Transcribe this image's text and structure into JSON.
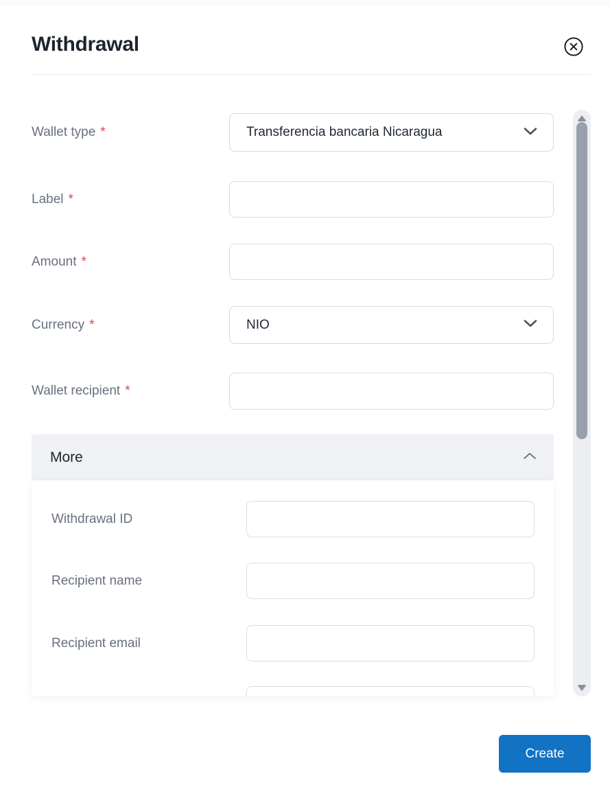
{
  "modal": {
    "title": "Withdrawal",
    "close_icon": "circled-x"
  },
  "form": {
    "required_marker": "*",
    "fields": [
      {
        "label": "Wallet type",
        "required": true,
        "type": "select",
        "value": "Transferencia bancaria Nicaragua"
      },
      {
        "label": "Label",
        "required": true,
        "type": "text",
        "value": "",
        "placeholder": ""
      },
      {
        "label": "Amount",
        "required": true,
        "type": "text",
        "value": "",
        "placeholder": ""
      },
      {
        "label": "Currency",
        "required": true,
        "type": "select",
        "value": "NIO"
      },
      {
        "label": "Wallet recipient",
        "required": true,
        "type": "text",
        "value": "",
        "placeholder": ""
      }
    ],
    "more": {
      "label": "More",
      "expanded": true,
      "chevron_icon": "chevron-up",
      "fields": [
        {
          "label": "Withdrawal ID",
          "value": "",
          "placeholder": ""
        },
        {
          "label": "Recipient name",
          "value": "",
          "placeholder": ""
        },
        {
          "label": "Recipient email",
          "value": "",
          "placeholder": ""
        }
      ]
    }
  },
  "scrollbar": {
    "orientation": "vertical"
  },
  "footer": {
    "create_label": "Create"
  },
  "colors": {
    "accent_blue": "#1272c3",
    "required_red": "#e0424d",
    "label_gray": "#68707e",
    "border_gray": "#d6dade",
    "more_header_bg": "#f0f1f4",
    "scroll_track": "#eceef1",
    "scroll_thumb": "#98a1ab",
    "title_dark": "#1e2530"
  }
}
